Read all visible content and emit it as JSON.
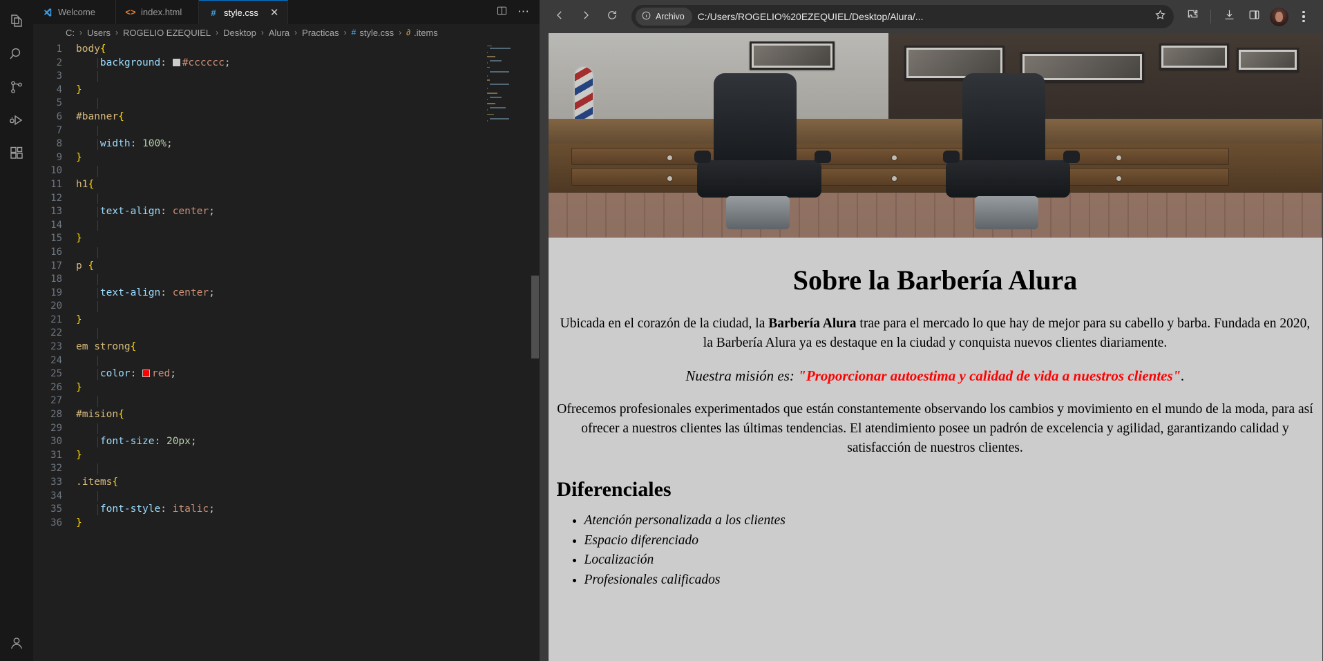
{
  "vscode": {
    "activity_bar": [
      {
        "name": "explorer",
        "icon": "files-icon"
      },
      {
        "name": "search",
        "icon": "search-icon"
      },
      {
        "name": "source-control",
        "icon": "source-control-icon"
      },
      {
        "name": "run-debug",
        "icon": "run-debug-icon"
      },
      {
        "name": "extensions",
        "icon": "extensions-icon"
      },
      {
        "name": "account",
        "icon": "account-icon"
      }
    ],
    "tabs": [
      {
        "label": "Welcome",
        "icon": "vscode-logo-icon",
        "active": false,
        "closable": false
      },
      {
        "label": "index.html",
        "icon": "html-icon",
        "active": false,
        "closable": false
      },
      {
        "label": "style.css",
        "icon": "css-icon",
        "active": true,
        "closable": true
      }
    ],
    "tab_actions": {
      "split_editor": "split-editor-icon",
      "more": "more-actions-icon",
      "close_label": "✕"
    },
    "breadcrumb": [
      {
        "label": "C:",
        "icon": ""
      },
      {
        "label": "Users",
        "icon": ""
      },
      {
        "label": "ROGELIO EZEQUIEL",
        "icon": ""
      },
      {
        "label": "Desktop",
        "icon": ""
      },
      {
        "label": "Alura",
        "icon": ""
      },
      {
        "label": "Practicas",
        "icon": ""
      },
      {
        "label": "style.css",
        "icon": "#"
      },
      {
        "label": ".items",
        "icon": "⁂"
      }
    ],
    "breadcrumb_separator": "›",
    "line_numbers": [
      1,
      2,
      3,
      4,
      5,
      6,
      7,
      8,
      9,
      10,
      11,
      12,
      13,
      14,
      15,
      16,
      17,
      18,
      19,
      20,
      21,
      22,
      23,
      24,
      25,
      26,
      27,
      28,
      29,
      30,
      31,
      32,
      33,
      34,
      35,
      36
    ],
    "code_lines": [
      {
        "n": 1,
        "text": "body{"
      },
      {
        "n": 2,
        "text": "    background:  #cccccc;",
        "swatch": "#cccccc"
      },
      {
        "n": 3,
        "text": ""
      },
      {
        "n": 4,
        "text": "}"
      },
      {
        "n": 5,
        "text": ""
      },
      {
        "n": 6,
        "text": "#banner{"
      },
      {
        "n": 7,
        "text": ""
      },
      {
        "n": 8,
        "text": "    width: 100%;"
      },
      {
        "n": 9,
        "text": "}"
      },
      {
        "n": 10,
        "text": ""
      },
      {
        "n": 11,
        "text": "h1{"
      },
      {
        "n": 12,
        "text": ""
      },
      {
        "n": 13,
        "text": "    text-align: center;"
      },
      {
        "n": 14,
        "text": ""
      },
      {
        "n": 15,
        "text": "}"
      },
      {
        "n": 16,
        "text": ""
      },
      {
        "n": 17,
        "text": "p {"
      },
      {
        "n": 18,
        "text": ""
      },
      {
        "n": 19,
        "text": "    text-align: center;"
      },
      {
        "n": 20,
        "text": ""
      },
      {
        "n": 21,
        "text": "}"
      },
      {
        "n": 22,
        "text": ""
      },
      {
        "n": 23,
        "text": "em strong{"
      },
      {
        "n": 24,
        "text": ""
      },
      {
        "n": 25,
        "text": "    color:  red;",
        "swatch": "#ff0000"
      },
      {
        "n": 26,
        "text": "}"
      },
      {
        "n": 27,
        "text": ""
      },
      {
        "n": 28,
        "text": "#mision{"
      },
      {
        "n": 29,
        "text": ""
      },
      {
        "n": 30,
        "text": "    font-size: 20px;"
      },
      {
        "n": 31,
        "text": "}"
      },
      {
        "n": 32,
        "text": ""
      },
      {
        "n": 33,
        "text": ".items{"
      },
      {
        "n": 34,
        "text": ""
      },
      {
        "n": 35,
        "text": "    font-style: italic;"
      },
      {
        "n": 36,
        "text": "}"
      }
    ]
  },
  "browser": {
    "nav": {
      "back": "back-arrow-icon",
      "forward": "forward-arrow-icon",
      "reload": "reload-icon"
    },
    "omnibox": {
      "badge_label": "Archivo",
      "badge_icon": "info-circle-icon",
      "url": "C:/Users/ROGELIO%20EZEQUIEL/Desktop/Alura/...",
      "bookmark_icon": "star-icon"
    },
    "toolbar_icons": [
      {
        "name": "extensions-puzzle-icon"
      },
      {
        "name": "downloads-icon"
      },
      {
        "name": "side-panel-icon"
      },
      {
        "name": "profile-avatar"
      },
      {
        "name": "chrome-menu-icon"
      }
    ]
  },
  "page": {
    "banner_alt": "Barbershop interior with two leather barber chairs, wooden cabinets and a barber pole",
    "title": "Sobre la Barbería Alura",
    "paragraph1_a": "Ubicada en el corazón de la ciudad, la ",
    "paragraph1_bold": "Barbería Alura",
    "paragraph1_b": " trae para el mercado lo que hay de mejor para su cabello y barba. Fundada en 2020, la Barbería Alura ya es destaque en la ciudad y conquista nuevos clientes diariamente.",
    "mision_label": "Nuestra misión es: ",
    "mision_quote": "\"Proporcionar autoestima y calidad de vida a nuestros clientes\"",
    "mision_end": ".",
    "paragraph3": "Ofrecemos profesionales experimentados que están constantemente observando los cambios y movimiento en el mundo de la moda, para así ofrecer a nuestros clientes las últimas tendencias. El atendimiento posee un padrón de excelencia y agilidad, garantizando calidad y satisfacción de nuestros clientes.",
    "subtitle": "Diferenciales",
    "diferenciales": [
      "Atención personalizada a los clientes",
      "Espacio diferenciado",
      "Localización",
      "Profesionales calificados"
    ]
  },
  "colors": {
    "page_background": "#cccccc",
    "accent_red": "#ff0000",
    "vscode_bg": "#1f1f1f",
    "tab_active_border": "#0078d4"
  }
}
